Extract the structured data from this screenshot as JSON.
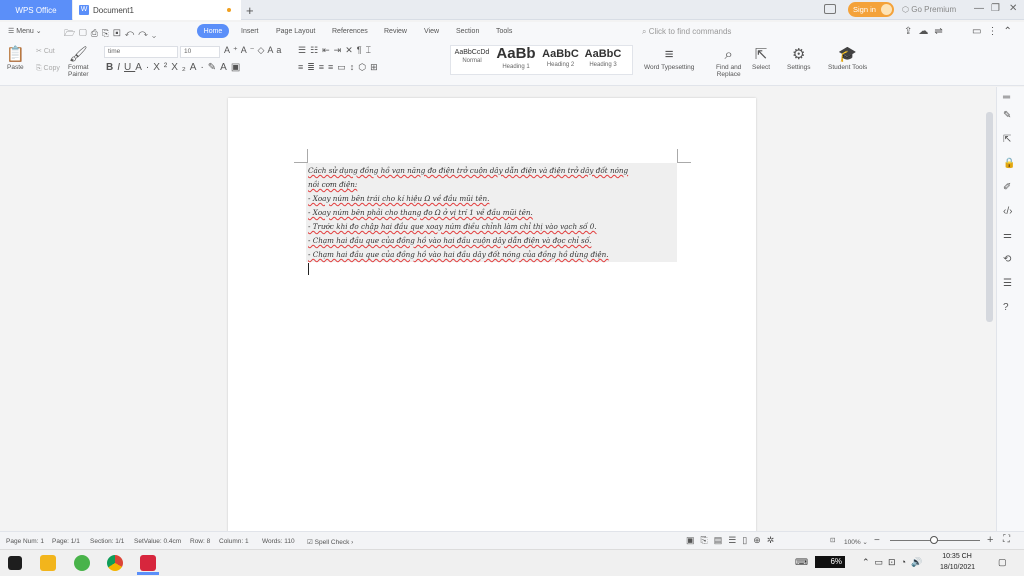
{
  "titlebar": {
    "app_tab": "WPS Office",
    "doc_tab": "Document1",
    "new_tab": "+",
    "sign_in": "Sign in",
    "premium": "Go Premium"
  },
  "menu": {
    "menu_label": "Menu",
    "tabs": [
      "Home",
      "Insert",
      "Page Layout",
      "References",
      "Review",
      "View",
      "Section",
      "Tools"
    ],
    "find_placeholder": "Click to find commands"
  },
  "ribbon": {
    "paste": "Paste",
    "cut": "Cut",
    "copy": "Copy",
    "format_painter_line1": "Format",
    "format_painter_line2": "Painter",
    "font_name": "time",
    "font_size": "10",
    "styles": [
      {
        "preview": "AaBbCcDd",
        "name": "Normal"
      },
      {
        "preview": "AaBb",
        "name": "Heading 1"
      },
      {
        "preview": "AaBbC",
        "name": "Heading 2"
      },
      {
        "preview": "AaBbC",
        "name": "Heading 3"
      }
    ],
    "word_typesetting": "Word Typesetting",
    "find_replace_line1": "Find and",
    "find_replace_line2": "Replace",
    "select": "Select",
    "settings": "Settings",
    "student_tools": "Student Tools"
  },
  "document": {
    "lines": [
      "Cách sử dụng đồng hồ vạn năng đo điện trở cuộn dây dẫn điện và điện trở dây đốt nóng",
      "nồi cơm điện:",
      "- Xoay núm bên trái cho kí hiệu Ω về đầu mũi tên.",
      "- Xoay núm bên phải cho thang đo Ω ở vị trí 1 về đầu mũi tên.",
      "- Trước khi đo chập hai đầu que xoay núm điều chỉnh làm chỉ thị vào vạch số 0.",
      "- Chạm hai đầu que của đồng hồ vào hai đầu cuộn dây dẫn điện và đọc chỉ số.",
      "- Chạm hai đầu que của đồng hồ vào hai đầu dây đốt nóng của đồng hồ dùng điện."
    ]
  },
  "status": {
    "page_num": "Page Num: 1",
    "page": "Page: 1/1",
    "section": "Section: 1/1",
    "set_value": "SetValue: 0.4cm",
    "row": "Row: 8",
    "column": "Column: 1",
    "words": "Words: 110",
    "spell_check": "Spell Check",
    "zoom": "100%"
  },
  "taskbar": {
    "battery": "6%",
    "time": "10:35 CH",
    "date": "18/10/2021"
  },
  "colors": {
    "accent": "#5b8ff9",
    "signin": "#f4a23a",
    "spell_underline": "#e23c3c"
  }
}
